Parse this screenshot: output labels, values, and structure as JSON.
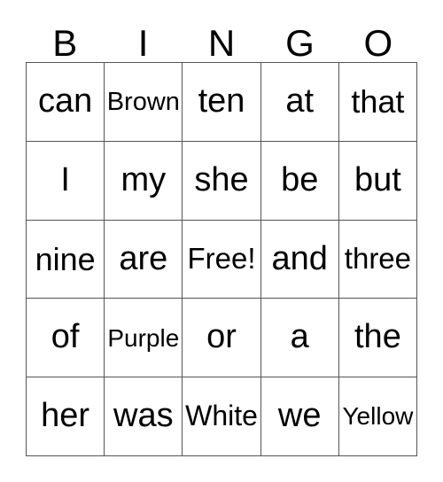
{
  "card": {
    "title": "BINGO",
    "header_letters": [
      "B",
      "I",
      "N",
      "G",
      "O"
    ],
    "grid": {
      "columns": 5,
      "rows": 5,
      "free_space": "Free!",
      "cells": [
        [
          "can",
          "Brown",
          "ten",
          "at",
          "that"
        ],
        [
          "I",
          "my",
          "she",
          "be",
          "but"
        ],
        [
          "nine",
          "are",
          "Free!",
          "and",
          "three"
        ],
        [
          "of",
          "Purple",
          "or",
          "a",
          "the"
        ],
        [
          "her",
          "was",
          "White",
          "we",
          "Yellow"
        ]
      ]
    },
    "colors": {
      "text": "#000000",
      "grid_line": "#555555",
      "background": "#ffffff"
    }
  }
}
